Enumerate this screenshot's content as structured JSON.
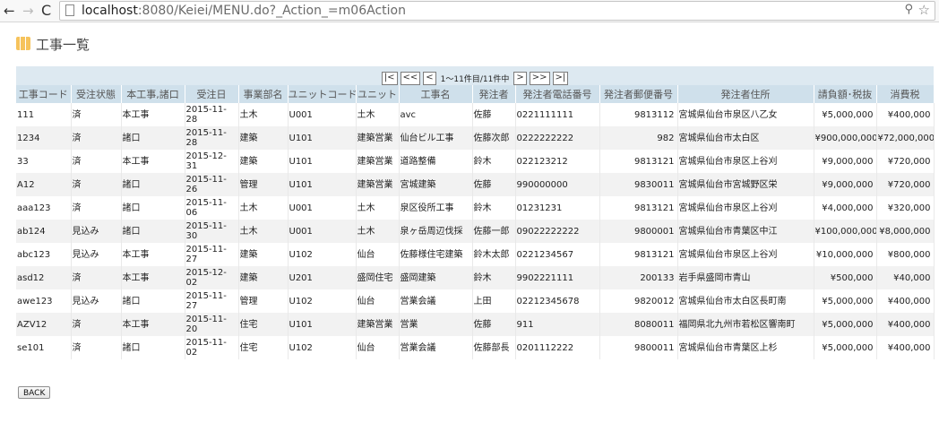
{
  "browser": {
    "back": "←",
    "forward": "→",
    "reload": "C",
    "url_host": "localhost",
    "url_path": ":8080/Keiei/MENU.do?_Action_=m06Action",
    "zoom": "⚲",
    "star": "☆"
  },
  "page": {
    "title": "工事一覧"
  },
  "pager": {
    "first": "|<",
    "prev_block": "<<",
    "prev": "<",
    "info": "1～11件目/11件中",
    "next": ">",
    "next_block": ">>",
    "last": ">|"
  },
  "table": {
    "columns": [
      "工事コード",
      "受注状態",
      "本工事,諸口",
      "受注日",
      "事業部名",
      "ユニットコード",
      "ユニット",
      "工事名",
      "発注者",
      "発注者電話番号",
      "発注者郵便番号",
      "発注者住所",
      "請負額･税抜",
      "消費税"
    ],
    "rows": [
      [
        "111",
        "済",
        "本工事",
        "2015-11-28",
        "土木",
        "U001",
        "土木",
        "avc",
        "佐藤",
        "0221111111",
        "9813112",
        "宮城県仙台市泉区八乙女",
        "¥5,000,000",
        "¥400,000"
      ],
      [
        "1234",
        "済",
        "諸口",
        "2015-11-28",
        "建築",
        "U101",
        "建築営業",
        "仙台ビル工事",
        "佐藤次郎",
        "0222222222",
        "982",
        "宮城県仙台市太白区",
        "¥900,000,000",
        "¥72,000,000"
      ],
      [
        "33",
        "済",
        "本工事",
        "2015-12-31",
        "建築",
        "U101",
        "建築営業",
        "道路整備",
        "鈴木",
        "022123212",
        "9813121",
        "宮城県仙台市泉区上谷刈",
        "¥9,000,000",
        "¥720,000"
      ],
      [
        "A12",
        "済",
        "諸口",
        "2015-11-26",
        "管理",
        "U101",
        "建築営業",
        "宮城建築",
        "佐藤",
        "990000000",
        "9830011",
        "宮城県仙台市宮城野区栄",
        "¥9,000,000",
        "¥720,000"
      ],
      [
        "aaa123",
        "済",
        "諸口",
        "2015-11-06",
        "土木",
        "U001",
        "土木",
        "泉区役所工事",
        "鈴木",
        "01231231",
        "9813121",
        "宮城県仙台市泉区上谷刈",
        "¥4,000,000",
        "¥320,000"
      ],
      [
        "ab124",
        "見込み",
        "諸口",
        "2015-11-30",
        "土木",
        "U001",
        "土木",
        "泉ヶ岳周辺伐採",
        "佐藤一郎",
        "09022222222",
        "9800001",
        "宮城県仙台市青葉区中江",
        "¥100,000,000",
        "¥8,000,000"
      ],
      [
        "abc123",
        "見込み",
        "本工事",
        "2015-11-27",
        "建築",
        "U102",
        "仙台",
        "佐藤様住宅建築",
        "鈴木太郎",
        "0221234567",
        "9813121",
        "宮城県仙台市泉区上谷刈",
        "¥10,000,000",
        "¥800,000"
      ],
      [
        "asd12",
        "済",
        "本工事",
        "2015-12-02",
        "建築",
        "U201",
        "盛岡住宅",
        "盛岡建築",
        "鈴木",
        "9902221111",
        "200133",
        "岩手県盛岡市青山",
        "¥500,000",
        "¥40,000"
      ],
      [
        "awe123",
        "見込み",
        "諸口",
        "2015-11-27",
        "管理",
        "U102",
        "仙台",
        "営業会議",
        "上田",
        "02212345678",
        "9820012",
        "宮城県仙台市太白区長町南",
        "¥5,000,000",
        "¥400,000"
      ],
      [
        "AZV12",
        "済",
        "本工事",
        "2015-11-20",
        "住宅",
        "U101",
        "建築営業",
        "営業",
        "佐藤",
        "911",
        "8080011",
        "福岡県北九州市若松区響南町",
        "¥5,000,000",
        "¥400,000"
      ],
      [
        "se101",
        "済",
        "諸口",
        "2015-11-02",
        "住宅",
        "U102",
        "仙台",
        "営業会議",
        "佐藤部長",
        "0201112222",
        "9800011",
        "宮城県仙台市青葉区上杉",
        "¥5,000,000",
        "¥400,000"
      ]
    ]
  },
  "actions": {
    "back_label": "BACK"
  }
}
